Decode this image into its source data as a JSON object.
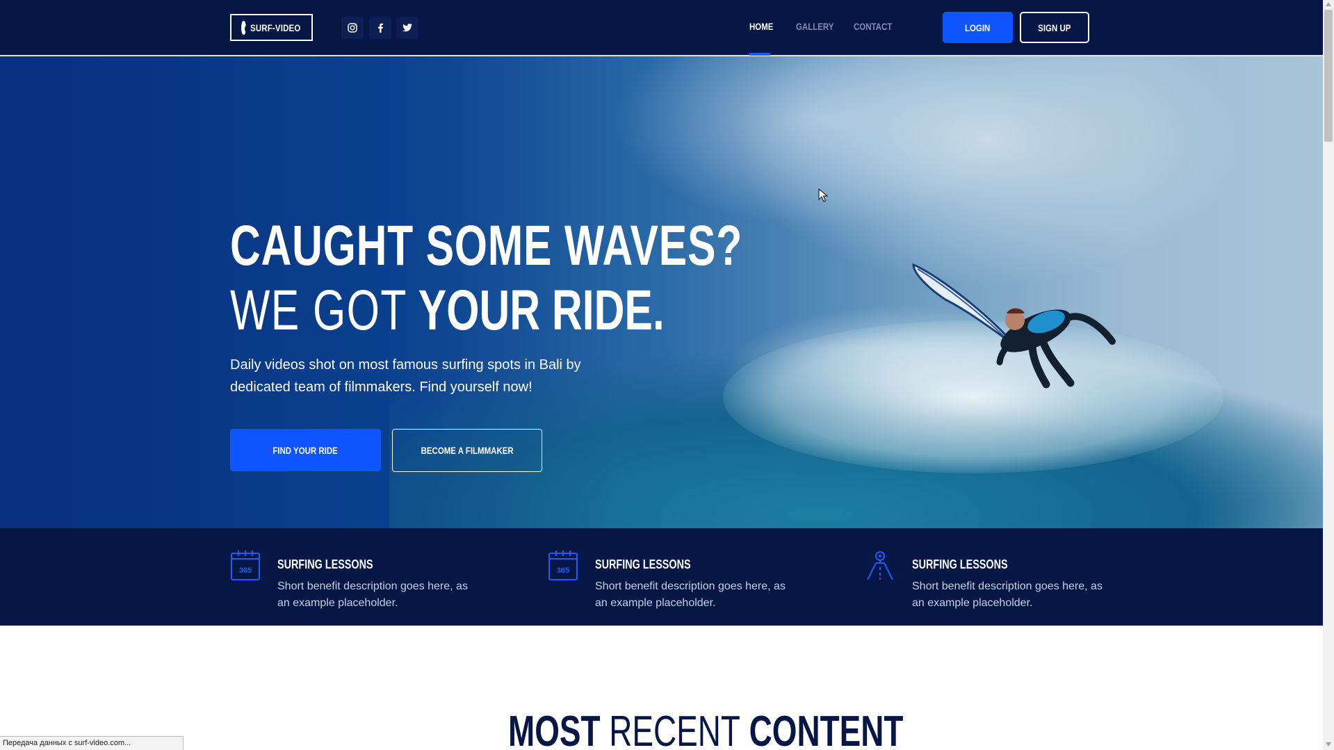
{
  "nav": {
    "logo_text": "SURF-VIDEO",
    "social_icons": [
      "instagram-icon",
      "facebook-icon",
      "twitter-icon"
    ],
    "links": [
      {
        "label": "HOME",
        "active": true
      },
      {
        "label": "GALLERY",
        "active": false
      },
      {
        "label": "CONTACT",
        "active": false
      }
    ],
    "login_label": "LOGIN",
    "signup_label": "SIGN UP"
  },
  "hero": {
    "title_line1": "CAUGHT SOME WAVES?",
    "title_line2_thin": "WE GOT",
    "title_line2_bold": "YOUR RIDE.",
    "description": "Daily videos shot on most famous surfing spots in Bali by dedicated team of filmmakers. Find yourself now!",
    "primary_button": "FIND YOUR RIDE",
    "secondary_button": "BECOME A FILMMAKER"
  },
  "benefits": [
    {
      "icon": "calendar-365-icon",
      "title": "SURFING LESSONS",
      "description": "Short benefit description goes here, as an example placeholder."
    },
    {
      "icon": "calendar-365-icon",
      "title": "SURFING LESSONS",
      "description": "Short benefit description goes here, as an example placeholder."
    },
    {
      "icon": "map-pin-road-icon",
      "title": "SURFING LESSONS",
      "description": "Short benefit description goes here, as an example placeholder."
    }
  ],
  "recent": {
    "heading_bold1": "MOST",
    "heading_thin": "RECENT",
    "heading_bold2": "CONTENT"
  },
  "status_bar": "Передача данных с surf-video.com...",
  "colors": {
    "navy": "#061746",
    "accent_blue": "#0f55ff",
    "white": "#ffffff"
  }
}
